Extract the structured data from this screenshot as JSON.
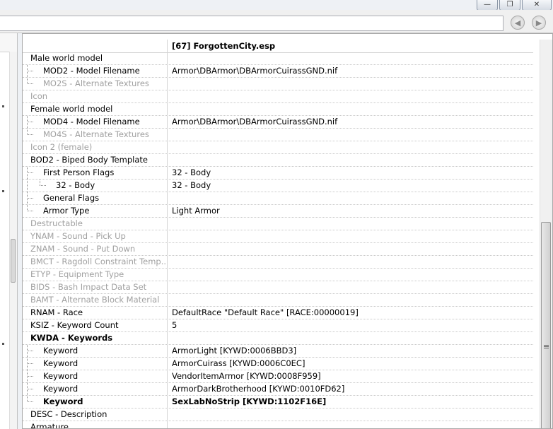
{
  "window": {
    "minimize_glyph": "—",
    "restore_glyph": "❐",
    "close_glyph": "✕"
  },
  "toolbar": {
    "back_glyph": "◀",
    "forward_glyph": "▶"
  },
  "grid": {
    "header": "[67] ForgottenCity.esp",
    "rows": [
      {
        "label": "Male world model",
        "value": "",
        "depth": 0,
        "style": "normal"
      },
      {
        "label": "MOD2 - Model Filename",
        "value": "Armor\\DBArmor\\DBArmorCuirassGND.nif",
        "depth": 1,
        "style": "normal"
      },
      {
        "label": "MO2S - Alternate Textures",
        "value": "",
        "depth": 1,
        "style": "grey",
        "last": true
      },
      {
        "label": "Icon",
        "value": "",
        "depth": 0,
        "style": "grey"
      },
      {
        "label": "Female world model",
        "value": "",
        "depth": 0,
        "style": "normal"
      },
      {
        "label": "MOD4 - Model Filename",
        "value": "Armor\\DBArmor\\DBArmorCuirassGND.nif",
        "depth": 1,
        "style": "normal"
      },
      {
        "label": "MO4S - Alternate Textures",
        "value": "",
        "depth": 1,
        "style": "grey",
        "last": true
      },
      {
        "label": "Icon 2 (female)",
        "value": "",
        "depth": 0,
        "style": "grey"
      },
      {
        "label": "BOD2 - Biped Body Template",
        "value": "",
        "depth": 0,
        "style": "normal"
      },
      {
        "label": "First Person Flags",
        "value": "32 - Body",
        "depth": 1,
        "style": "normal"
      },
      {
        "label": "32 - Body",
        "value": "32 - Body",
        "depth": 2,
        "style": "normal",
        "last": true
      },
      {
        "label": "General Flags",
        "value": "",
        "depth": 1,
        "style": "normal"
      },
      {
        "label": "Armor Type",
        "value": "Light Armor",
        "depth": 1,
        "style": "normal",
        "last": true
      },
      {
        "label": "Destructable",
        "value": "",
        "depth": 0,
        "style": "grey"
      },
      {
        "label": "YNAM - Sound - Pick Up",
        "value": "",
        "depth": 0,
        "style": "grey"
      },
      {
        "label": "ZNAM - Sound - Put Down",
        "value": "",
        "depth": 0,
        "style": "grey"
      },
      {
        "label": "BMCT - Ragdoll Constraint Temp...",
        "value": "",
        "depth": 0,
        "style": "grey"
      },
      {
        "label": "ETYP - Equipment Type",
        "value": "",
        "depth": 0,
        "style": "grey"
      },
      {
        "label": "BIDS - Bash Impact Data Set",
        "value": "",
        "depth": 0,
        "style": "grey"
      },
      {
        "label": "BAMT - Alternate Block Material",
        "value": "",
        "depth": 0,
        "style": "grey"
      },
      {
        "label": "RNAM - Race",
        "value": "DefaultRace \"Default Race\" [RACE:00000019]",
        "depth": 0,
        "style": "normal"
      },
      {
        "label": "KSIZ - Keyword Count",
        "value": "5",
        "depth": 0,
        "style": "normal"
      },
      {
        "label": "KWDA - Keywords",
        "value": "",
        "depth": 0,
        "style": "bold"
      },
      {
        "label": "Keyword",
        "value": "ArmorLight [KYWD:0006BBD3]",
        "depth": 1,
        "style": "normal"
      },
      {
        "label": "Keyword",
        "value": "ArmorCuirass [KYWD:0006C0EC]",
        "depth": 1,
        "style": "normal"
      },
      {
        "label": "Keyword",
        "value": "VendorItemArmor [KYWD:0008F959]",
        "depth": 1,
        "style": "normal"
      },
      {
        "label": "Keyword",
        "value": "ArmorDarkBrotherhood [KYWD:0010FD62]",
        "depth": 1,
        "style": "normal"
      },
      {
        "label": "Keyword",
        "value": "SexLabNoStrip [KYWD:1102F16E]",
        "depth": 1,
        "style": "bold",
        "last": true
      },
      {
        "label": "DESC - Description",
        "value": "",
        "depth": 0,
        "style": "normal"
      },
      {
        "label": "Armature",
        "value": "",
        "depth": 0,
        "style": "normal"
      }
    ]
  }
}
